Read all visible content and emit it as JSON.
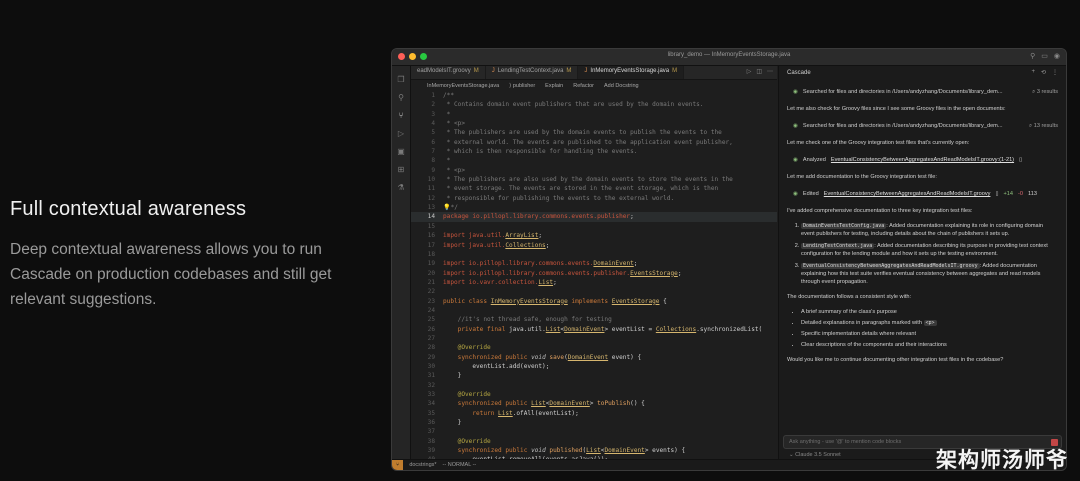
{
  "hero": {
    "title": "Full contextual awareness",
    "desc": "Deep contextual awareness allows you to run Cascade on production codebases and still get relevant suggestions."
  },
  "window": {
    "title": "library_demo — InMemoryEventsStorage.java"
  },
  "tabs": [
    {
      "label": "eadModelsIT.groovy",
      "mod": "M"
    },
    {
      "label": "LendingTestContext.java",
      "mod": "M"
    },
    {
      "label": "InMemoryEventsStorage.java",
      "mod": "M"
    }
  ],
  "breadcrumbs": {
    "file": "InMemoryEventsStorage.java",
    "symbol": "publisher",
    "actions": [
      "Explain",
      "Refactor",
      "Add Docstring"
    ]
  },
  "code": [
    {
      "n": "1",
      "t": [
        [
          "cm",
          "/**"
        ]
      ]
    },
    {
      "n": "2",
      "t": [
        [
          "cm",
          " * Contains domain event publishers that are used by the domain events."
        ]
      ]
    },
    {
      "n": "3",
      "t": [
        [
          "cm",
          " *"
        ]
      ]
    },
    {
      "n": "4",
      "t": [
        [
          "cm",
          " * <p>"
        ]
      ]
    },
    {
      "n": "5",
      "t": [
        [
          "cm",
          " * The publishers are used by the domain events to publish the events to the"
        ]
      ]
    },
    {
      "n": "6",
      "t": [
        [
          "cm",
          " * external world. The events are published to the application event publisher,"
        ]
      ]
    },
    {
      "n": "7",
      "t": [
        [
          "cm",
          " * which is then responsible for handling the events."
        ]
      ]
    },
    {
      "n": "8",
      "t": [
        [
          "cm",
          " *"
        ]
      ]
    },
    {
      "n": "9",
      "t": [
        [
          "cm",
          " * <p>"
        ]
      ]
    },
    {
      "n": "10",
      "t": [
        [
          "cm",
          " * The publishers are also used by the domain events to store the events in the"
        ]
      ]
    },
    {
      "n": "11",
      "t": [
        [
          "cm",
          " * event storage. The events are stored in the event storage, which is then"
        ]
      ]
    },
    {
      "n": "12",
      "t": [
        [
          "cm",
          " * responsible for publishing the events to the external world."
        ]
      ]
    },
    {
      "n": "13",
      "t": [
        [
          "cm",
          "💡*/"
        ]
      ]
    },
    {
      "n": "14",
      "hl": true,
      "t": [
        [
          "pk",
          "package io.pillopl.library.commons.events.publisher"
        ],
        [
          "",
          "; "
        ]
      ]
    },
    {
      "n": "15",
      "t": []
    },
    {
      "n": "16",
      "t": [
        [
          "pk",
          "import java.util."
        ],
        [
          "ty",
          "ArrayList"
        ],
        [
          "",
          ";"
        ]
      ]
    },
    {
      "n": "17",
      "t": [
        [
          "pk",
          "import java.util."
        ],
        [
          "ty",
          "Collections"
        ],
        [
          "",
          ";"
        ]
      ]
    },
    {
      "n": "18",
      "t": []
    },
    {
      "n": "19",
      "t": [
        [
          "pk",
          "import io.pillopl.library.commons.events."
        ],
        [
          "ty",
          "DomainEvent"
        ],
        [
          "",
          ";"
        ]
      ]
    },
    {
      "n": "20",
      "t": [
        [
          "pk",
          "import io.pillopl.library.commons.events.publisher."
        ],
        [
          "ty",
          "EventsStorage"
        ],
        [
          "",
          ";"
        ]
      ]
    },
    {
      "n": "21",
      "t": [
        [
          "pk",
          "import io.vavr.collection."
        ],
        [
          "ty",
          "List"
        ],
        [
          "",
          ";"
        ]
      ]
    },
    {
      "n": "22",
      "t": []
    },
    {
      "n": "23",
      "t": [
        [
          "kw",
          "public class "
        ],
        [
          "ty",
          "InMemoryEventsStorage"
        ],
        [
          "kw",
          " implements "
        ],
        [
          "ty",
          "EventsStorage"
        ],
        [
          "",
          " {"
        ]
      ]
    },
    {
      "n": "24",
      "t": []
    },
    {
      "n": "25",
      "t": [
        [
          "cm",
          "    //it's not thread safe, enough for testing"
        ]
      ]
    },
    {
      "n": "26",
      "t": [
        [
          "kw",
          "    private final "
        ],
        [
          "",
          "java.util."
        ],
        [
          "ty",
          "List"
        ],
        [
          "",
          "<"
        ],
        [
          "ty",
          "DomainEvent"
        ],
        [
          "",
          "> eventList = "
        ],
        [
          "ty",
          "Collections"
        ],
        [
          "",
          ".synchronizedList("
        ]
      ]
    },
    {
      "n": "27",
      "t": []
    },
    {
      "n": "28",
      "t": [
        [
          "an",
          "    @Override"
        ]
      ]
    },
    {
      "n": "29",
      "t": [
        [
          "kw",
          "    synchronized public "
        ],
        [
          "it",
          "void "
        ],
        [
          "fn",
          "save"
        ],
        [
          "",
          "("
        ],
        [
          "ty",
          "DomainEvent"
        ],
        [
          "",
          " event) {"
        ]
      ]
    },
    {
      "n": "30",
      "t": [
        [
          "",
          "        eventList.add(event);"
        ]
      ]
    },
    {
      "n": "31",
      "t": [
        [
          "",
          "    }"
        ]
      ]
    },
    {
      "n": "32",
      "t": []
    },
    {
      "n": "33",
      "t": [
        [
          "an",
          "    @Override"
        ]
      ]
    },
    {
      "n": "34",
      "t": [
        [
          "kw",
          "    synchronized public "
        ],
        [
          "ty",
          "List"
        ],
        [
          "",
          "<"
        ],
        [
          "ty",
          "DomainEvent"
        ],
        [
          "",
          "> "
        ],
        [
          "fn",
          "toPublish"
        ],
        [
          "",
          "() {"
        ]
      ]
    },
    {
      "n": "35",
      "t": [
        [
          "kw",
          "        return "
        ],
        [
          "ty",
          "List"
        ],
        [
          "",
          ".ofAll(eventList);"
        ]
      ]
    },
    {
      "n": "36",
      "t": [
        [
          "",
          "    }"
        ]
      ]
    },
    {
      "n": "37",
      "t": []
    },
    {
      "n": "38",
      "t": [
        [
          "an",
          "    @Override"
        ]
      ]
    },
    {
      "n": "39",
      "t": [
        [
          "kw",
          "    synchronized public "
        ],
        [
          "it",
          "void "
        ],
        [
          "fn",
          "published"
        ],
        [
          "",
          "("
        ],
        [
          "ty",
          "List"
        ],
        [
          "",
          "<"
        ],
        [
          "ty",
          "DomainEvent"
        ],
        [
          "",
          "> events) {"
        ]
      ]
    },
    {
      "n": "40",
      "t": [
        [
          "",
          "        eventList.removeAll(events.asJava());"
        ]
      ]
    }
  ],
  "cascade": {
    "title": "Cascade",
    "t0": "Searched for files and directories in /Users/andyzhang/Documents/library_dem...",
    "r0": "3 results",
    "m1": "Let me also check for Groovy files since I see some Groovy files in the open documents:",
    "t1": "Searched for files and directories in /Users/andyzhang/Documents/library_dem...",
    "r1": "13 results",
    "m2": "Let me check one of the Groovy integration test files that's currently open:",
    "t2a": "Analyzed",
    "t2b": "EventualConsistencyBetweenAggregatesAndReadModelsIT.groovy:(1-21)",
    "m3": "Let me add documentation to the Groovy integration test file:",
    "t3a": "Edited",
    "t3b": "EventualConsistencyBetweenAggregatesAndReadModelsIT.groovy",
    "add": "+14",
    "del": "-0",
    "cnt": "113",
    "m4": "I've added comprehensive documentation to three key integration test files:",
    "l1c": "DomainEventsTestConfig.java",
    "l1t": ": Added documentation explaining its role in configuring domain event publishers for testing, including details about the chain of publishers it sets up.",
    "l2c": "LendingTestContext.java",
    "l2t": ": Added documentation describing its purpose in providing test context configuration for the lending module and how it sets up the testing environment.",
    "l3c": "EventualConsistencyBetweenAggregatesAndReadModelsIT.groovy",
    "l3t": ": Added documentation explaining how this test suite verifies eventual consistency between aggregates and read models through event propagation.",
    "m5": "The documentation follows a consistent style with:",
    "b1": "A brief summary of the class's purpose",
    "b2": "Detailed explanations in paragraphs marked with",
    "b2c": "<p>",
    "b3": "Specific implementation details where relevant",
    "b4": "Clear descriptions of the components and their interactions",
    "m6": "Would you like me to continue documenting other integration test files in the codebase?",
    "placeholder": "Ask anything - use '@' to mention code blocks",
    "model": "Claude 3.5 Sonnet"
  },
  "status": {
    "branch": "docstrings*",
    "mode": "-- NORMAL --"
  },
  "watermark": "架构师汤师爷",
  "colors": {
    "accent": "#c07d2e",
    "traffic": [
      "#ff5f57",
      "#febc2e",
      "#28c840"
    ]
  }
}
